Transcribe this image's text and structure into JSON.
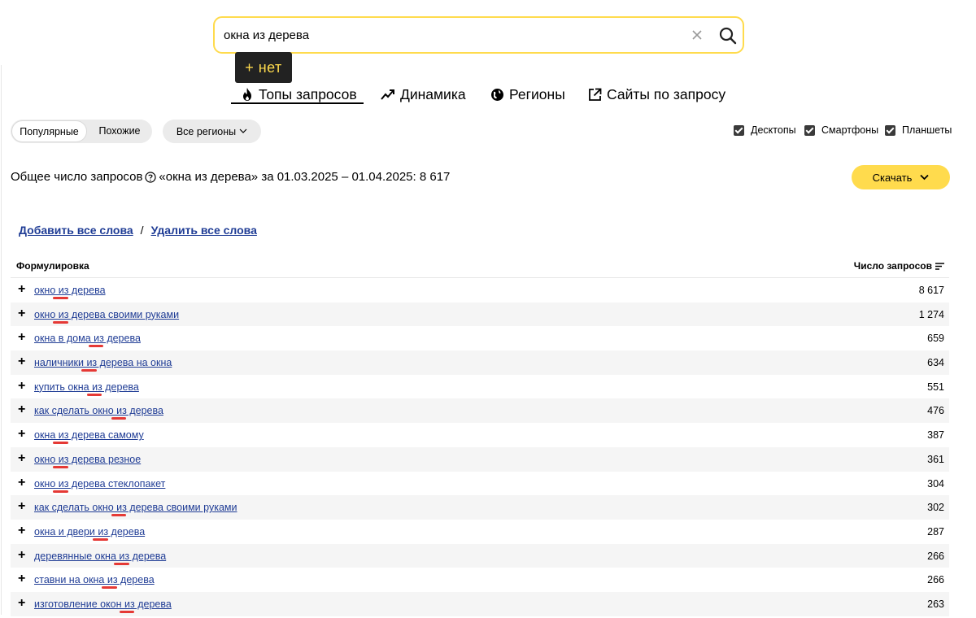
{
  "search": {
    "value": "окна из дерева",
    "clear_icon": "close-icon",
    "search_icon": "search-icon"
  },
  "tooltip": "+ нет",
  "tabs": [
    {
      "label": "Топы запросов",
      "icon": "fire-icon",
      "active": true
    },
    {
      "label": "Динамика",
      "icon": "trend-icon"
    },
    {
      "label": "Регионы",
      "icon": "globe-icon"
    },
    {
      "label": "Сайты по запросу",
      "icon": "external-link-icon"
    }
  ],
  "filters": {
    "popular": "Популярные",
    "similar": "Похожие",
    "regions": "Все регионы",
    "devices": [
      {
        "label": "Десктопы",
        "checked": true
      },
      {
        "label": "Смартфоны",
        "checked": true
      },
      {
        "label": "Планшеты",
        "checked": true
      }
    ]
  },
  "summary": {
    "prefix": "Общее число запросов",
    "text": "«окна из дерева» за 01.03.2025 – 01.04.2025: 8 617"
  },
  "download_label": "Скачать",
  "actions": {
    "add_all": "Добавить все слова",
    "separator": "/",
    "remove_all": "Удалить все слова"
  },
  "table": {
    "col_phrase": "Формулировка",
    "col_count": "Число запросов",
    "rows": [
      {
        "phrase": "окно из дерева",
        "count": "8 617"
      },
      {
        "phrase": "окно из дерева своими руками",
        "count": "1 274"
      },
      {
        "phrase": "окна в дома из дерева",
        "count": "659"
      },
      {
        "phrase": "наличники из дерева на окна",
        "count": "634"
      },
      {
        "phrase": "купить окна из дерева",
        "count": "551"
      },
      {
        "phrase": "как сделать окно из дерева",
        "count": "476"
      },
      {
        "phrase": "окна из дерева самому",
        "count": "387"
      },
      {
        "phrase": "окно из дерева резное",
        "count": "361"
      },
      {
        "phrase": "окно из дерева стеклопакет",
        "count": "304"
      },
      {
        "phrase": "как сделать окно из дерева своими руками",
        "count": "302"
      },
      {
        "phrase": "окна и двери из дерева",
        "count": "287"
      },
      {
        "phrase": "деревянные окна из дерева",
        "count": "266"
      },
      {
        "phrase": "ставни на окна из дерева",
        "count": "266"
      },
      {
        "phrase": "изготовление окон из дерева",
        "count": "263"
      }
    ]
  },
  "colors": {
    "accent": "#ffdb4d",
    "link": "#1f3c95",
    "mark": "#e53935"
  }
}
